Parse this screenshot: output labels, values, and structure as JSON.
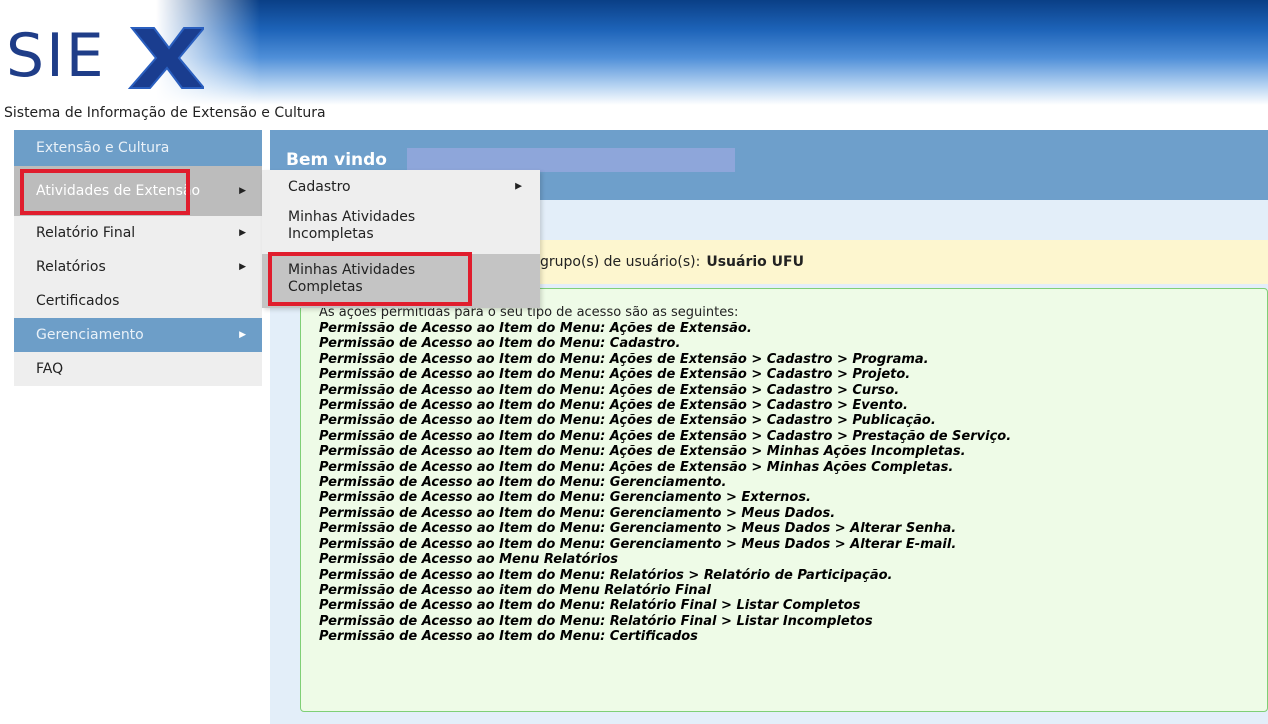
{
  "header": {
    "logo_text": "SIEX",
    "subtitle": "Sistema de Informação de Extensão e Cultura"
  },
  "sidebar": {
    "items": [
      {
        "label": "Extensão e Cultura"
      },
      {
        "label": "Atividades de Extensão"
      },
      {
        "label": "Relatório Final"
      },
      {
        "label": "Relatórios"
      },
      {
        "label": "Certificados"
      },
      {
        "label": "Gerenciamento"
      },
      {
        "label": "FAQ"
      }
    ]
  },
  "dropdown": {
    "items": [
      {
        "label": "Cadastro"
      },
      {
        "label": "Minhas Atividades Incompletas"
      },
      {
        "label": "Minhas Atividades Completas"
      }
    ]
  },
  "main": {
    "welcome": "Bem vindo",
    "group_prefix": "grupo(s) de usuário(s):",
    "group_value": "Usuário UFU",
    "perm_intro": "As ações permitidas para o seu tipo de acesso são as seguintes:",
    "permissions": [
      "Permissão de Acesso ao Item do Menu: Ações de Extensão.",
      "Permissão de Acesso ao Item do Menu: Cadastro.",
      "Permissão de Acesso ao Item do Menu: Ações de Extensão > Cadastro > Programa.",
      "Permissão de Acesso ao Item do Menu: Ações de Extensão > Cadastro > Projeto.",
      "Permissão de Acesso ao Item do Menu: Ações de Extensão > Cadastro > Curso.",
      "Permissão de Acesso ao Item do Menu: Ações de Extensão > Cadastro > Evento.",
      "Permissão de Acesso ao Item do Menu: Ações de Extensão > Cadastro > Publicação.",
      "Permissão de Acesso ao Item do Menu: Ações de Extensão > Cadastro > Prestação de Serviço.",
      "Permissão de Acesso ao Item do Menu: Ações de Extensão > Minhas Ações Incompletas.",
      "Permissão de Acesso ao Item do Menu: Ações de Extensão > Minhas Ações Completas.",
      "Permissão de Acesso ao Item do Menu: Gerenciamento.",
      "Permissão de Acesso ao Item do Menu: Gerenciamento > Externos.",
      "Permissão de Acesso ao Item do Menu: Gerenciamento > Meus Dados.",
      "Permissão de Acesso ao Item do Menu: Gerenciamento > Meus Dados > Alterar Senha.",
      "Permissão de Acesso ao Item do Menu: Gerenciamento > Meus Dados > Alterar E-mail.",
      "Permissão de Acesso ao Menu Relatórios",
      "Permissão de Acesso ao Item do Menu: Relatórios > Relatório de Participação.",
      "Permissão de Acesso ao item do Menu Relatório Final",
      "Permissão de Acesso ao Item do Menu: Relatório Final > Listar Completos",
      "Permissão de Acesso ao Item do Menu: Relatório Final > Listar Incompletos",
      "Permissão de Acesso ao Item do Menu: Certificados"
    ]
  },
  "colors": {
    "accent_red": "#e01d2d",
    "sidebar_blue": "#6d9ec8",
    "welcome_blue": "#6e9fcb"
  }
}
